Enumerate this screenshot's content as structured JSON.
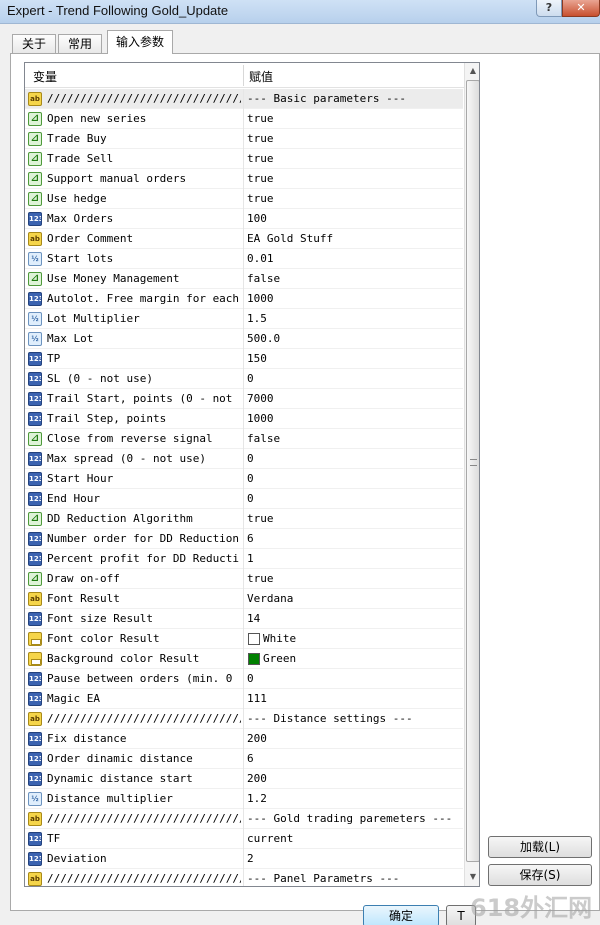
{
  "window": {
    "title": "Expert - Trend Following Gold_Update",
    "help_label": "?",
    "close_label": "✕"
  },
  "tabs": [
    "关于",
    "常用",
    "输入参数"
  ],
  "active_tab": 2,
  "grid": {
    "col_variable": "变量",
    "col_value": "赋值",
    "rows": [
      {
        "type": "ab",
        "name": "///////////////////////////////////////",
        "value": "--- Basic parameters ---"
      },
      {
        "type": "b",
        "name": "Open new series",
        "value": "true"
      },
      {
        "type": "b",
        "name": "Trade Buy",
        "value": "true"
      },
      {
        "type": "b",
        "name": "Trade Sell",
        "value": "true"
      },
      {
        "type": "b",
        "name": "Support manual orders",
        "value": "true"
      },
      {
        "type": "b",
        "name": "Use hedge",
        "value": "true"
      },
      {
        "type": "n",
        "name": "Max Orders",
        "value": "100"
      },
      {
        "type": "ab",
        "name": "Order Comment",
        "value": "EA Gold Stuff"
      },
      {
        "type": "d",
        "name": "Start lots",
        "value": "0.01"
      },
      {
        "type": "b",
        "name": "Use Money Management",
        "value": "false"
      },
      {
        "type": "n",
        "name": "Autolot. Free margin for each...",
        "value": "1000"
      },
      {
        "type": "d",
        "name": "Lot Multiplier",
        "value": "1.5"
      },
      {
        "type": "d",
        "name": "Max Lot",
        "value": "500.0"
      },
      {
        "type": "n",
        "name": "TP",
        "value": "150"
      },
      {
        "type": "n",
        "name": "SL (0 - not use)",
        "value": "0"
      },
      {
        "type": "n",
        "name": "Trail Start, points (0 - not ...",
        "value": "7000"
      },
      {
        "type": "n",
        "name": "Trail Step, points",
        "value": "1000"
      },
      {
        "type": "b",
        "name": "Close from reverse signal",
        "value": "false"
      },
      {
        "type": "n",
        "name": "Max spread (0 - not use)",
        "value": "0"
      },
      {
        "type": "n",
        "name": "Start Hour",
        "value": "0"
      },
      {
        "type": "n",
        "name": "End Hour",
        "value": "0"
      },
      {
        "type": "b",
        "name": "DD Reduction Algorithm",
        "value": "true"
      },
      {
        "type": "n",
        "name": "Number order for DD Reduction...",
        "value": "6"
      },
      {
        "type": "n",
        "name": "Percent profit for DD Reducti...",
        "value": "1"
      },
      {
        "type": "b",
        "name": "Draw on-off",
        "value": "true"
      },
      {
        "type": "ab",
        "name": "Font Result",
        "value": "Verdana"
      },
      {
        "type": "n",
        "name": "Font size Result",
        "value": "14"
      },
      {
        "type": "c",
        "name": "Font color Result",
        "value": "White",
        "swatch": "#ffffff"
      },
      {
        "type": "c",
        "name": "Background color Result",
        "value": "Green",
        "swatch": "#008000"
      },
      {
        "type": "n",
        "name": "Pause between orders (min. 0 ...",
        "value": "0"
      },
      {
        "type": "n",
        "name": "Magic EA",
        "value": "111"
      },
      {
        "type": "ab",
        "name": "///////////////////////////////////////",
        "value": "--- Distance settings ---"
      },
      {
        "type": "n",
        "name": "Fix distance",
        "value": "200"
      },
      {
        "type": "n",
        "name": "Order dinamic distance",
        "value": "6"
      },
      {
        "type": "n",
        "name": "Dynamic distance start",
        "value": "200"
      },
      {
        "type": "d",
        "name": "Distance multiplier",
        "value": "1.2"
      },
      {
        "type": "ab",
        "name": "///////////////////////////////////////",
        "value": "--- Gold trading paremeters ---"
      },
      {
        "type": "n",
        "name": "TF",
        "value": "current"
      },
      {
        "type": "n",
        "name": "Deviation",
        "value": "2"
      },
      {
        "type": "ab",
        "name": "///////////////////////////////////////",
        "value": "--- Panel Parametrs ---"
      }
    ]
  },
  "icon_glyphs": {
    "ab": "ab",
    "b": "⊿",
    "n": "123",
    "d": "½",
    "c": ""
  },
  "buttons": {
    "load": "加载(L)",
    "save": "保存(S)",
    "ok": "确定",
    "cancel": "T"
  },
  "watermark": "618外汇网"
}
